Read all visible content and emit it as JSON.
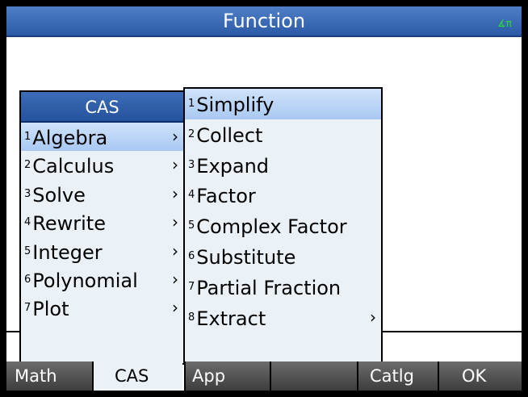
{
  "title": "Function",
  "angle_indicator": "∡π",
  "cas_menu": {
    "header": "CAS",
    "items": [
      {
        "num": "1",
        "label": "Algebra",
        "arrow": "›"
      },
      {
        "num": "2",
        "label": "Calculus",
        "arrow": "›"
      },
      {
        "num": "3",
        "label": "Solve",
        "arrow": "›"
      },
      {
        "num": "4",
        "label": "Rewrite",
        "arrow": "›"
      },
      {
        "num": "5",
        "label": "Integer",
        "arrow": "›"
      },
      {
        "num": "6",
        "label": "Polynomial",
        "arrow": "›"
      },
      {
        "num": "7",
        "label": "Plot",
        "arrow": "›"
      }
    ]
  },
  "algebra_submenu": {
    "items": [
      {
        "num": "1",
        "label": "Simplify",
        "arrow": ""
      },
      {
        "num": "2",
        "label": "Collect",
        "arrow": ""
      },
      {
        "num": "3",
        "label": "Expand",
        "arrow": ""
      },
      {
        "num": "4",
        "label": "Factor",
        "arrow": ""
      },
      {
        "num": "5",
        "label": "Complex Factor",
        "arrow": ""
      },
      {
        "num": "6",
        "label": "Substitute",
        "arrow": ""
      },
      {
        "num": "7",
        "label": "Partial Fraction",
        "arrow": ""
      },
      {
        "num": "8",
        "label": "Extract",
        "arrow": "›"
      }
    ]
  },
  "softkeys": {
    "math": "Math",
    "cas": "CAS",
    "app": "App",
    "blank": "",
    "catlg": "Catlg",
    "ok": "OK"
  }
}
